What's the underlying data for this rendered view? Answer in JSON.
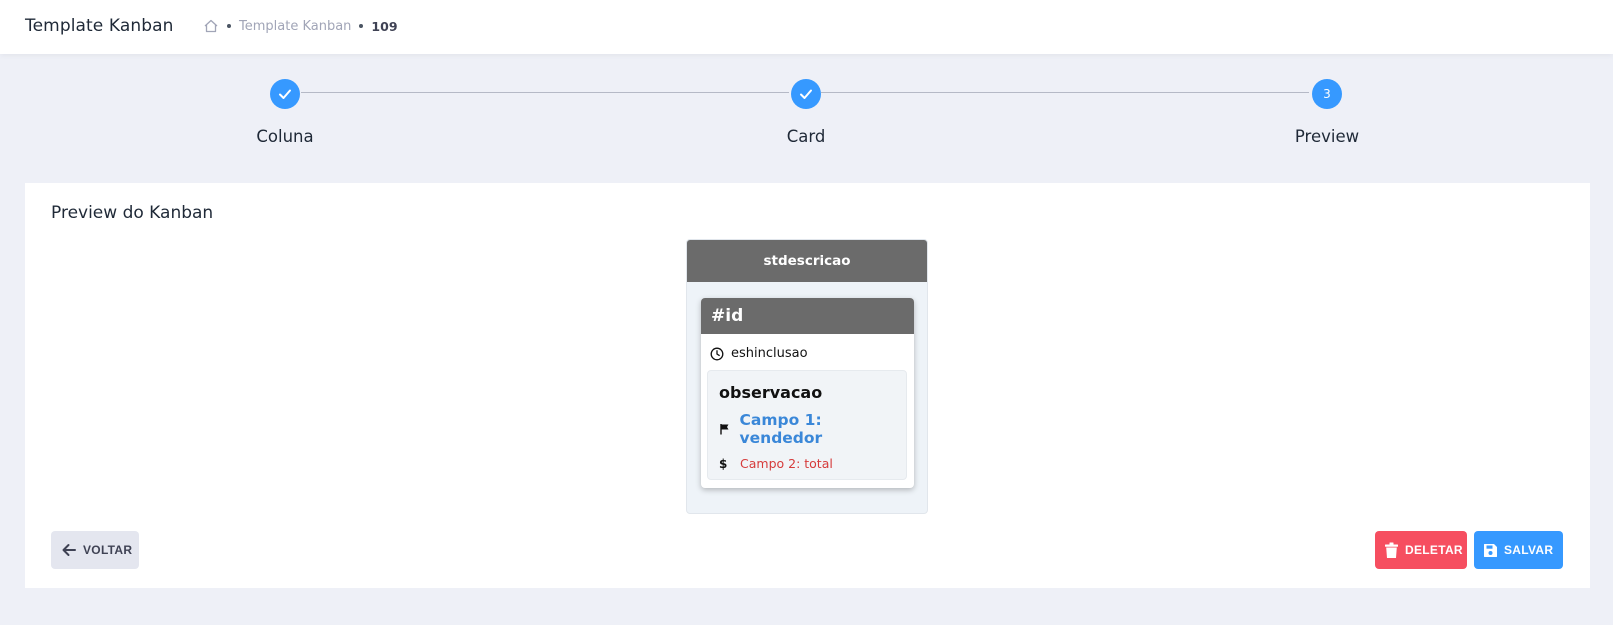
{
  "header": {
    "app_title": "Template Kanban",
    "breadcrumb": {
      "home_icon": "home-icon",
      "link": "Template Kanban",
      "current": "109"
    }
  },
  "stepper": {
    "steps": [
      {
        "label": "Coluna",
        "status": "completed",
        "icon": "check-icon"
      },
      {
        "label": "Card",
        "status": "completed",
        "icon": "check-icon"
      },
      {
        "label": "Preview",
        "status": "current",
        "number": "3"
      }
    ],
    "accent_color": "#3699ff"
  },
  "panel": {
    "title": "Preview do Kanban",
    "kanban": {
      "column_header": "stdescricao",
      "card": {
        "header": "#id",
        "date_field": "eshinclusao",
        "observation": "observacao",
        "field1": "Campo 1: vendedor",
        "field2": "Campo 2: total"
      }
    },
    "buttons": {
      "back": "VOLTAR",
      "delete": "DELETAR",
      "save": "SALVAR"
    }
  },
  "colors": {
    "danger": "#f64e60",
    "primary": "#3699ff",
    "card_header": "#6b6b6b",
    "field1": "#3a87d8",
    "field2": "#d63b3b"
  }
}
